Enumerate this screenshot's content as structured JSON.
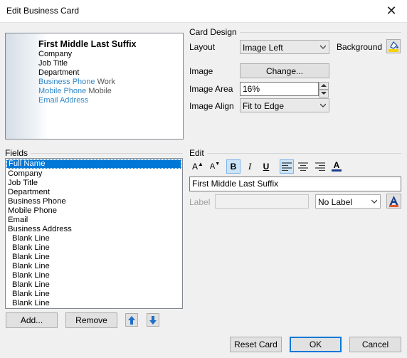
{
  "window": {
    "title": "Edit Business Card",
    "close_glyph": "✕"
  },
  "preview": {
    "name": "First Middle Last Suffix",
    "company": "Company",
    "job_title": "Job Title",
    "department": "Department",
    "business_phone": "Business Phone",
    "business_phone_label": "Work",
    "mobile_phone": "Mobile Phone",
    "mobile_phone_label": "Mobile",
    "email": "Email Address"
  },
  "card_design": {
    "group_label": "Card Design",
    "layout_label": "Layout",
    "layout_value": "Image Left",
    "background_label": "Background",
    "image_label": "Image",
    "change_button": "Change...",
    "image_area_label": "Image Area",
    "image_area_value": "16%",
    "image_align_label": "Image Align",
    "image_align_value": "Fit to Edge"
  },
  "fields": {
    "group_label": "Fields",
    "items": [
      "Full Name",
      "Company",
      "Job Title",
      "Department",
      "Business Phone",
      "Mobile Phone",
      "Email",
      "Business Address",
      "Blank Line",
      "Blank Line",
      "Blank Line",
      "Blank Line",
      "Blank Line",
      "Blank Line",
      "Blank Line",
      "Blank Line"
    ],
    "selected_index": 0,
    "add_button": "Add...",
    "remove_button": "Remove"
  },
  "edit": {
    "group_label": "Edit",
    "text_value": "First Middle Last Suffix",
    "label_label": "Label",
    "label_value": "",
    "label_combo_value": "No Label",
    "tools": {
      "grow": "A",
      "shrink": "A",
      "bold": "B",
      "italic": "I",
      "underline": "U",
      "color": "A"
    }
  },
  "footer": {
    "reset_button": "Reset Card",
    "ok_button": "OK",
    "cancel_button": "Cancel"
  },
  "colors": {
    "accent": "#0078d7",
    "link_blue": "#2f87c8",
    "selection": "#0078d7"
  }
}
